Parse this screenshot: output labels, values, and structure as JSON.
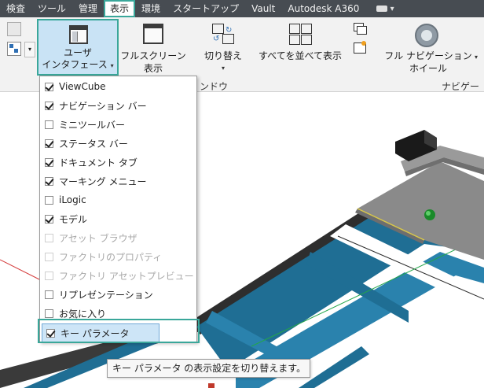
{
  "tabs": [
    {
      "label": "検査",
      "active": false
    },
    {
      "label": "ツール",
      "active": false
    },
    {
      "label": "管理",
      "active": false
    },
    {
      "label": "表示",
      "active": true
    },
    {
      "label": "環境",
      "active": false
    },
    {
      "label": "スタートアップ",
      "active": false
    },
    {
      "label": "Vault",
      "active": false
    },
    {
      "label": "Autodesk A360",
      "active": false
    }
  ],
  "ribbon": {
    "user_interface": {
      "line1": "ユーザ",
      "line2": "インタフェース"
    },
    "fullscreen": {
      "line1": "フルスクリーン",
      "line2": "表示"
    },
    "switch": {
      "label": "切り替え"
    },
    "arrange_all": {
      "label": "すべてを並べて表示"
    },
    "full_navigation": {
      "line1": "フル ナビゲーション",
      "line2": "ホイール"
    },
    "window_panel_label": "ンドウ",
    "navigation_panel_label": "ナビゲーシ"
  },
  "menu": {
    "items": [
      {
        "label": "ViewCube",
        "checked": true,
        "enabled": true
      },
      {
        "label": "ナビゲーション バー",
        "checked": true,
        "enabled": true
      },
      {
        "label": "ミニツールバー",
        "checked": false,
        "enabled": true
      },
      {
        "label": "ステータス バー",
        "checked": true,
        "enabled": true
      },
      {
        "label": "ドキュメント タブ",
        "checked": true,
        "enabled": true
      },
      {
        "label": "マーキング メニュー",
        "checked": true,
        "enabled": true
      },
      {
        "label": "iLogic",
        "checked": false,
        "enabled": true
      },
      {
        "label": "モデル",
        "checked": true,
        "enabled": true
      },
      {
        "label": "アセット ブラウザ",
        "checked": false,
        "enabled": false
      },
      {
        "label": "ファクトリのプロパティ",
        "checked": false,
        "enabled": false
      },
      {
        "label": "ファクトリ アセットプレビュー",
        "checked": false,
        "enabled": false
      },
      {
        "label": "リプレゼンテーション",
        "checked": false,
        "enabled": true
      },
      {
        "label": "お気に入り",
        "checked": false,
        "enabled": true
      },
      {
        "label": "キー パラメータ",
        "checked": true,
        "enabled": true,
        "highlighted": true
      }
    ]
  },
  "tooltip": {
    "text": "キー パラメータ の表示設定を切り替えます。"
  },
  "colors": {
    "accent_frame": "#3aa79a",
    "tab_bar": "#474c52",
    "highlight": "#cde5f7",
    "frame_blue": "#1f6e94"
  }
}
